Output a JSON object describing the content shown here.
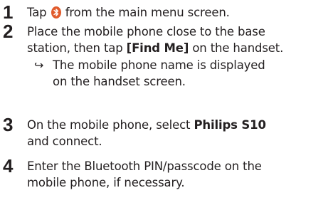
{
  "steps": [
    {
      "num": "1",
      "pre": "Tap",
      "icon": "bluetooth-icon",
      "post": "from the main menu screen."
    },
    {
      "num": "2",
      "line1": "Place the mobile phone close to the base",
      "line2_pre": "station, then tap",
      "line2_strong": "[Find Me]",
      "line2_post": "on the handset.",
      "result_arrow": "↪",
      "result_line1": "The mobile phone name is displayed",
      "result_line2": "on the handset screen."
    },
    {
      "num": "3",
      "line1_pre": "On the mobile phone, select",
      "line1_strong": "Philips S10",
      "line2": "and connect."
    },
    {
      "num": "4",
      "line1": "Enter the Bluetooth PIN/passcode on the",
      "line2": "mobile phone, if necessary."
    }
  ],
  "colors": {
    "text": "#231f20",
    "icon_bg": "#e15b2c"
  }
}
